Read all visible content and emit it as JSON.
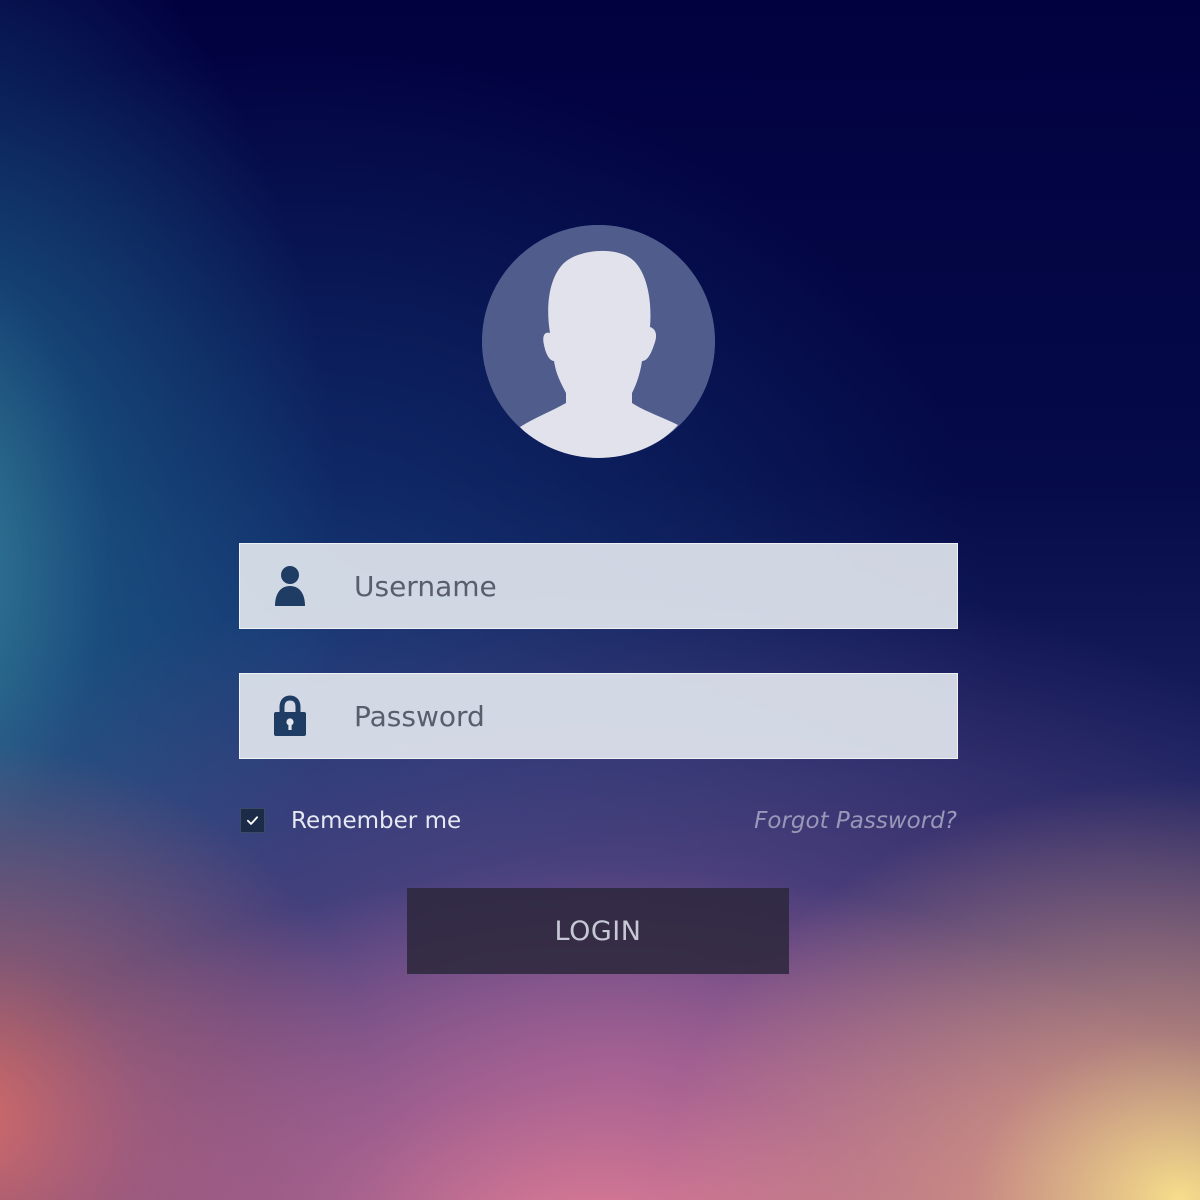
{
  "avatar": {
    "icon": "user-silhouette-icon"
  },
  "username": {
    "icon": "user-icon",
    "placeholder": "Username",
    "value": ""
  },
  "password": {
    "icon": "lock-icon",
    "placeholder": "Password",
    "value": ""
  },
  "remember": {
    "label": "Remember me",
    "checked": true
  },
  "forgot_password": {
    "label": "Forgot Password?"
  },
  "login_button": {
    "label": "LOGIN"
  },
  "colors": {
    "field_background": "#e1e6ee",
    "icon": "#1f3c64",
    "button_background": "#2d283e",
    "checkbox": "#1b2b48"
  }
}
